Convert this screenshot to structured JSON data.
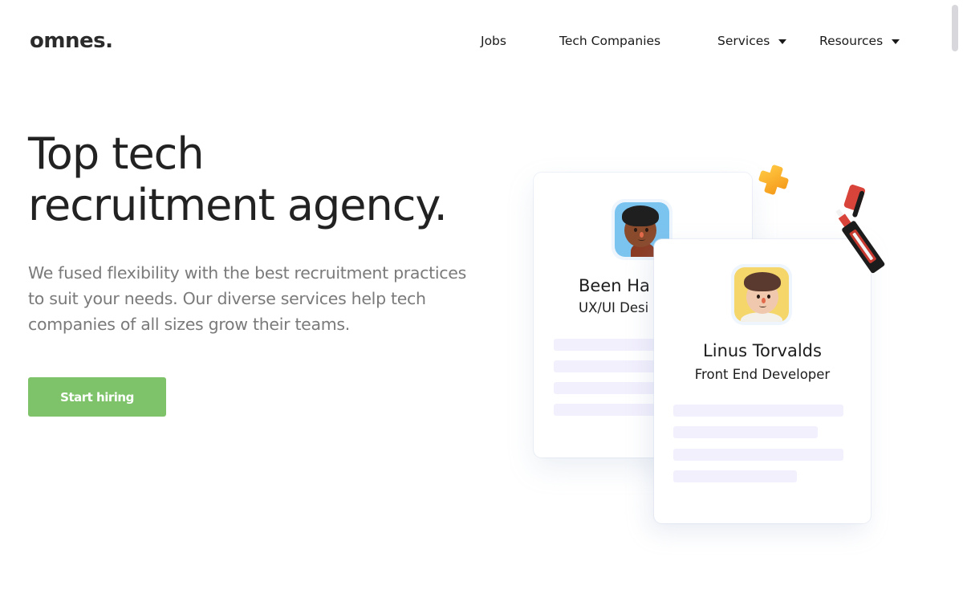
{
  "header": {
    "logo": "omnes",
    "logo_dot": ".",
    "nav": [
      {
        "label": "Jobs",
        "dropdown": false
      },
      {
        "label": "Tech Companies",
        "dropdown": false
      },
      {
        "label": "Services",
        "dropdown": true
      },
      {
        "label": "Resources",
        "dropdown": true
      }
    ]
  },
  "hero": {
    "title_line1": "Top tech",
    "title_line2": "recruitment agency.",
    "description": "We fused flexibility with the best recruitment practices to suit your needs. Our diverse services help tech companies of all sizes grow their teams.",
    "cta_label": "Start hiring"
  },
  "illustration": {
    "cards": [
      {
        "name": "Been Ha",
        "role": "UX/UI Desi",
        "avatar_bg": "#7cc4f0"
      },
      {
        "name": "Linus Torvalds",
        "role": "Front End Developer",
        "avatar_bg": "#f5d66a"
      }
    ],
    "decorations": [
      "plus-shape",
      "highlighter-marker"
    ]
  },
  "colors": {
    "accent": "#7ec36a",
    "text_primary": "#222222",
    "text_secondary": "#7a7a7a",
    "placeholder_line": "#f2f0fd"
  }
}
